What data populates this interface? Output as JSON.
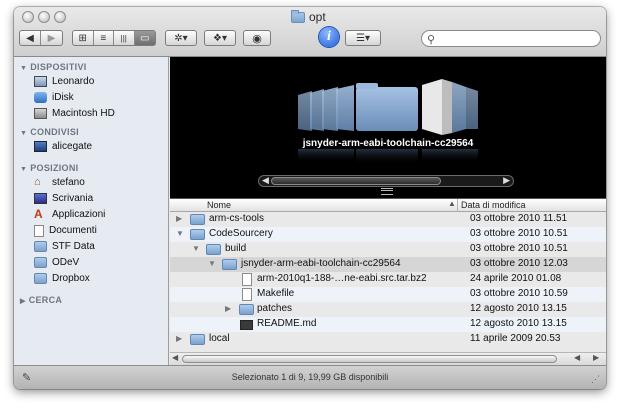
{
  "window": {
    "title": "opt"
  },
  "toolbar": {
    "back": "◀",
    "forward": "▶",
    "view_icons": "⊞",
    "view_list": "≡",
    "view_columns": "|||",
    "view_coverflow": "▭",
    "action": "✲▾",
    "dropbox": "❖▾",
    "quicklook": "◉",
    "info": "i",
    "arrange": "☰▾",
    "search_placeholder": ""
  },
  "sidebar": {
    "sections": [
      {
        "label": "DISPOSITIVI",
        "items": [
          {
            "label": "Leonardo",
            "icon": "computer-icon"
          },
          {
            "label": "iDisk",
            "icon": "idisk-icon"
          },
          {
            "label": "Macintosh HD",
            "icon": "harddisk-icon"
          }
        ]
      },
      {
        "label": "CONDIVISI",
        "items": [
          {
            "label": "alicegate",
            "icon": "network-computer-icon"
          }
        ]
      },
      {
        "label": "POSIZIONI",
        "items": [
          {
            "label": "stefano",
            "icon": "home-icon"
          },
          {
            "label": "Scrivania",
            "icon": "desktop-icon"
          },
          {
            "label": "Applicazioni",
            "icon": "applications-icon"
          },
          {
            "label": "Documenti",
            "icon": "documents-icon"
          },
          {
            "label": "STF Data",
            "icon": "folder-icon"
          },
          {
            "label": "ODeV",
            "icon": "folder-icon"
          },
          {
            "label": "Dropbox",
            "icon": "folder-icon"
          }
        ]
      },
      {
        "label": "CERCA",
        "items": []
      }
    ]
  },
  "coverflow": {
    "caption": "jsnyder-arm-eabi-toolchain-cc29564"
  },
  "list": {
    "headers": {
      "name": "Nome",
      "date": "Data di modifica"
    },
    "rows": [
      {
        "name": "arm-cs-tools",
        "date": "03 ottobre 2010 11.51",
        "type": "folder",
        "depth": 0,
        "disclosure": "closed"
      },
      {
        "name": "CodeSourcery",
        "date": "03 ottobre 2010 10.51",
        "type": "folder",
        "depth": 0,
        "disclosure": "open"
      },
      {
        "name": "build",
        "date": "03 ottobre 2010 10.51",
        "type": "folder",
        "depth": 1,
        "disclosure": "open"
      },
      {
        "name": "jsnyder-arm-eabi-toolchain-cc29564",
        "date": "03 ottobre 2010 12.03",
        "type": "folder",
        "depth": 2,
        "disclosure": "open",
        "selected": true
      },
      {
        "name": "arm-2010q1-188-…ne-eabi.src.tar.bz2",
        "date": "24 aprile 2010 01.08",
        "type": "document",
        "depth": 3,
        "disclosure": "none"
      },
      {
        "name": "Makefile",
        "date": "03 ottobre 2010 10.59",
        "type": "document",
        "depth": 3,
        "disclosure": "none"
      },
      {
        "name": "patches",
        "date": "12 agosto 2010 13.15",
        "type": "folder",
        "depth": 3,
        "disclosure": "closed"
      },
      {
        "name": "README.md",
        "date": "12 agosto 2010 13.15",
        "type": "dark",
        "depth": 3,
        "disclosure": "none"
      },
      {
        "name": "local",
        "date": "11 aprile 2009 20.53",
        "type": "folder",
        "depth": 0,
        "disclosure": "closed"
      }
    ]
  },
  "status": {
    "text": "Selezionato 1 di 9, 19,99 GB disponibili"
  }
}
